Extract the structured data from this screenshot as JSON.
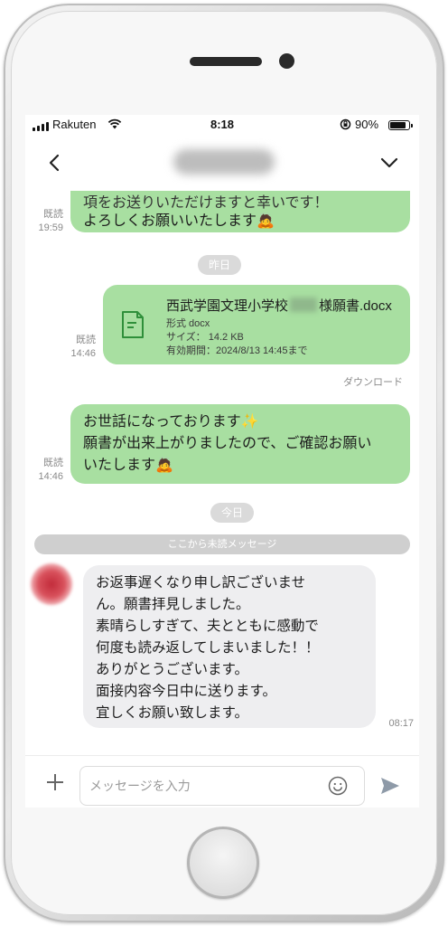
{
  "status_bar": {
    "carrier": "Rakuten",
    "time": "8:18",
    "battery": "90%"
  },
  "header": {
    "contact_name": "■■■■■■■■",
    "back_icon": "chevron-left-icon",
    "menu_icon": "chevron-down-icon"
  },
  "messages": {
    "m1": {
      "line1": "項をお送りいただけますと幸いです！",
      "line2": "よろしくお願いいたします",
      "status": "既読",
      "time": "19:59"
    },
    "date_yesterday": "昨日",
    "file": {
      "name_prefix": "西武学園文理小学校",
      "name_suffix": "様願書.docx",
      "format": "形式 docx",
      "size": "サイズ： 14.2 KB",
      "expiry": "有効期間：2024/8/13 14:45まで",
      "status": "既読",
      "time": "14:46",
      "download": "ダウンロード"
    },
    "m3": {
      "line1": "お世話になっております",
      "line2": "願書が出来上がりましたので、ご確認お願い",
      "line3": "いたします",
      "status": "既読",
      "time": "14:46"
    },
    "date_today": "今日",
    "unread_divider": "ここから未読メッセージ",
    "m4": {
      "lines": [
        "お返事遅くなり申し訳ございませ",
        "ん。願書拝見しました。",
        "素晴らしすぎて、夫とともに感動で",
        "何度も読み返してしまいました！！",
        "ありがとうございます。",
        "面接内容今日中に送ります。",
        "宜しくお願い致します。"
      ],
      "time": "08:17"
    }
  },
  "input": {
    "placeholder": "メッセージを入力"
  },
  "colors": {
    "bubble_green": "#a8dfa1",
    "bubble_gray": "#eeeef0",
    "pill": "#dadada"
  }
}
